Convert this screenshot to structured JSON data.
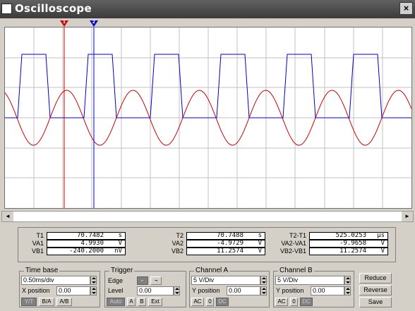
{
  "window": {
    "title": "Oscilloscope",
    "close_glyph": "×"
  },
  "cursors": [
    {
      "label": "1",
      "color": "#d40000"
    },
    {
      "label": "2",
      "color": "#0000d4"
    }
  ],
  "colors": {
    "channel_a": "#cc0000",
    "channel_b": "#0000cc",
    "grid": "#c0c0c0",
    "screen": "#ffffff"
  },
  "chart_data": {
    "type": "line",
    "series": [
      {
        "name": "Channel A",
        "shape": "sine",
        "color": "#cc0000"
      },
      {
        "name": "Channel B",
        "shape": "square",
        "color": "#0000cc"
      }
    ],
    "grid": true
  },
  "scroll": {
    "left_glyph": "◄",
    "right_glyph": "►"
  },
  "readout": {
    "t1": {
      "label": "T1",
      "value": "70.7482",
      "unit": "s"
    },
    "va1": {
      "label": "VA1",
      "value": "4.9930",
      "unit": "V"
    },
    "vb1": {
      "label": "VB1",
      "value": "-240.2000",
      "unit": "nV"
    },
    "t2": {
      "label": "T2",
      "value": "70.7488",
      "unit": "s"
    },
    "va2": {
      "label": "VA2",
      "value": "-4.9729",
      "unit": "V"
    },
    "vb2": {
      "label": "VB2",
      "value": "11.2574",
      "unit": "V"
    },
    "dt": {
      "label": "T2-T1",
      "value": "525.0253",
      "unit": "μs"
    },
    "dva": {
      "label": "VA2-VA1",
      "value": "-9.9658",
      "unit": "V"
    },
    "dvb": {
      "label": "VB2-VB1",
      "value": "11.2574",
      "unit": "V"
    }
  },
  "timebase": {
    "title": "Time base",
    "scale": "0.50ms/div",
    "xpos_label": "X position",
    "xpos": "0.00",
    "buttons": [
      "Y/T",
      "B/A",
      "A/B"
    ]
  },
  "trigger": {
    "title": "Trigger",
    "edge_label": "Edge",
    "level_label": "Level",
    "level": "0.00",
    "buttons": [
      "Auto",
      "A",
      "B",
      "Ext"
    ]
  },
  "channel_a": {
    "title": "Channel A",
    "scale": "5 V/Div",
    "ypos_label": "Y position",
    "ypos": "0.00",
    "buttons": [
      "AC",
      "0",
      "DC"
    ]
  },
  "channel_b": {
    "title": "Channel B",
    "scale": "5 V/Div",
    "ypos_label": "Y position",
    "ypos": "0.00",
    "buttons": [
      "AC",
      "0",
      "DC"
    ]
  },
  "actions": {
    "reduce": "Reduce",
    "reverse": "Reverse",
    "save": "Save"
  }
}
